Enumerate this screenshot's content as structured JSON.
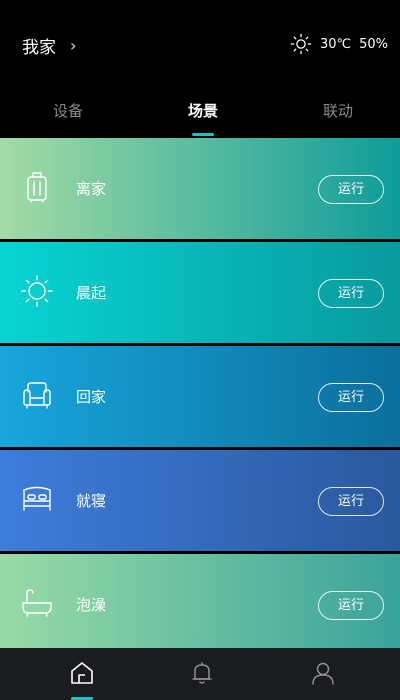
{
  "header": {
    "home_title": "我家",
    "chevron": "›",
    "weather_icon": "sun-icon",
    "temperature": "30℃",
    "humidity": "50%"
  },
  "tabs": [
    {
      "label": "设备",
      "active": false
    },
    {
      "label": "场景",
      "active": true
    },
    {
      "label": "联动",
      "active": false
    }
  ],
  "scenes": [
    {
      "label": "离家",
      "icon": "luggage-icon",
      "button": "运行",
      "colors": [
        "#a3dba5",
        "#0e9c9a"
      ]
    },
    {
      "label": "晨起",
      "icon": "sun-icon",
      "button": "运行",
      "colors": [
        "#08d4d3",
        "#089a9e"
      ]
    },
    {
      "label": "回家",
      "icon": "armchair-icon",
      "button": "运行",
      "colors": [
        "#18a6dc",
        "#0b6f9c"
      ]
    },
    {
      "label": "就寝",
      "icon": "bed-icon",
      "button": "运行",
      "colors": [
        "#3e7ddc",
        "#2a589d"
      ]
    },
    {
      "label": "泡澡",
      "icon": "bathtub-icon",
      "button": "运行",
      "colors": [
        "#98dba7",
        "#3aa39b"
      ]
    }
  ],
  "bottom_nav": [
    {
      "icon": "home-icon",
      "active": true
    },
    {
      "icon": "bell-icon",
      "active": false
    },
    {
      "icon": "user-icon",
      "active": false
    }
  ],
  "accent_color": "#1ec0c8"
}
